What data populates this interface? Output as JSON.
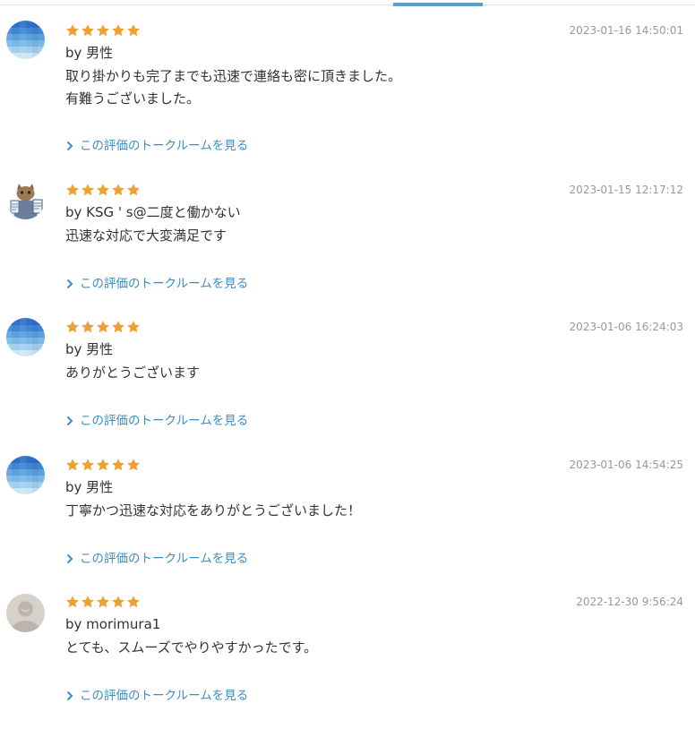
{
  "colors": {
    "star": "#f0a030",
    "link": "#3b8dc4",
    "date": "#999999",
    "text": "#333333",
    "accent": "#5aa0cf"
  },
  "reviews": [
    {
      "avatar": "blue-gradient",
      "rating": 5,
      "date": "2023-01-16 14:50:01",
      "by": "by 男性",
      "comment": "取り掛かりも完了までも迅速で連絡も密に頂きました。\n有難うございました。",
      "link": "この評価のトークルームを見る"
    },
    {
      "avatar": "cat-photo",
      "rating": 5,
      "date": "2023-01-15 12:17:12",
      "by": "by KSG ' s@二度と働かない",
      "comment": "迅速な対応で大変満足です",
      "link": "この評価のトークルームを見る"
    },
    {
      "avatar": "blue-gradient",
      "rating": 5,
      "date": "2023-01-06 16:24:03",
      "by": "by 男性",
      "comment": "ありがとうございます",
      "link": "この評価のトークルームを見る"
    },
    {
      "avatar": "blue-gradient",
      "rating": 5,
      "date": "2023-01-06 14:54:25",
      "by": "by 男性",
      "comment": "丁寧かつ迅速な対応をありがとうございました！",
      "link": "この評価のトークルームを見る"
    },
    {
      "avatar": "default-person",
      "rating": 5,
      "date": "2022-12-30 9:56:24",
      "by": "by morimura1",
      "comment": "とても、スムーズでやりやすかったです。",
      "link": "この評価のトークルームを見る"
    }
  ]
}
